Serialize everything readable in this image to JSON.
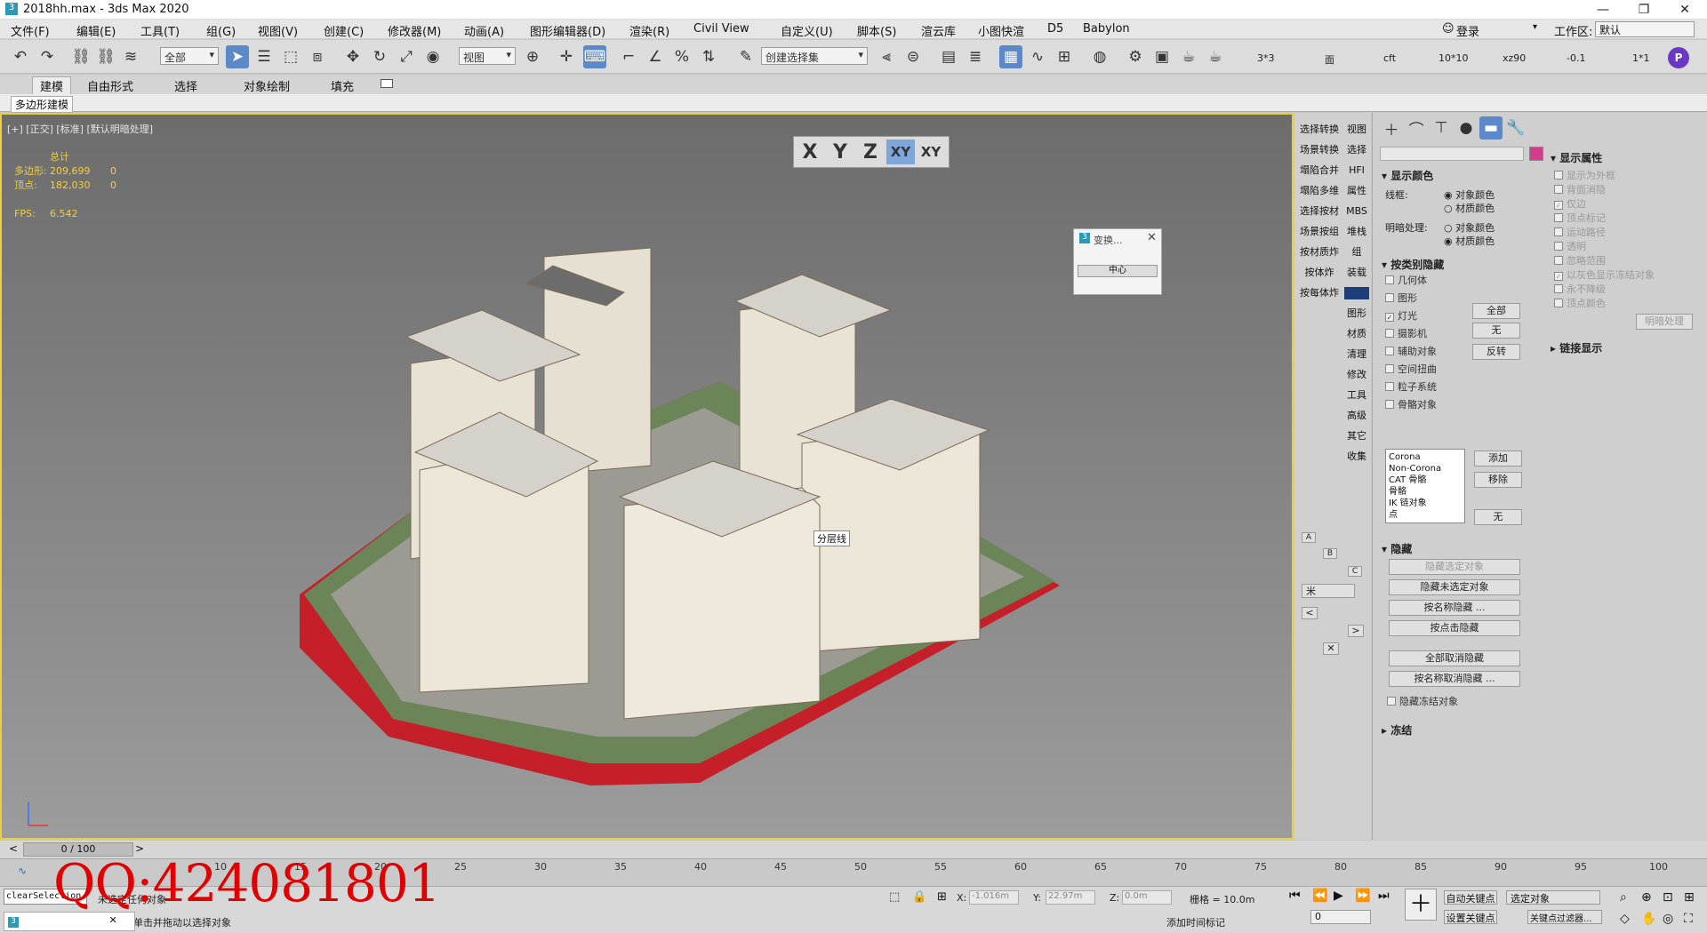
{
  "title": {
    "file": "2018hh.max - 3ds Max 2020"
  },
  "menu": [
    "文件(F)",
    "编辑(E)",
    "工具(T)",
    "组(G)",
    "视图(V)",
    "创建(C)",
    "修改器(M)",
    "动画(A)",
    "图形编辑器(D)",
    "渲染(R)",
    "Civil View",
    "自定义(U)",
    "脚本(S)",
    "渲云库",
    "小图快渲",
    "D5",
    "Babylon"
  ],
  "user": {
    "login": "登录",
    "workspace_label": "工作区:",
    "workspace_value": "默认"
  },
  "toolbar": {
    "filter": "全部",
    "refcoord": "视图",
    "selset": "创建选择集",
    "t1": "3*3",
    "t2": "面",
    "t3": "cft",
    "t4": "10*10",
    "t5": "xz90",
    "t6": "-0.1",
    "t7": "1*1"
  },
  "ribbon": {
    "tabs": [
      "建模",
      "自由形式",
      "选择",
      "对象绘制",
      "填充"
    ],
    "sub": "多边形建模"
  },
  "viewport": {
    "label": "[+] [正交] [标准] [默认明暗处理]",
    "stats_total": "总计",
    "poly_label": "多边形:",
    "poly_value": "209,699",
    "poly_sel": "0",
    "vert_label": "顶点:",
    "vert_value": "182,030",
    "vert_sel": "0",
    "fps_label": "FPS:",
    "fps_value": "6.542",
    "tooltip": "分层线"
  },
  "axis": [
    "X",
    "Y",
    "Z",
    "XY",
    "XY"
  ],
  "popup": {
    "title": "变换...",
    "button": "中心"
  },
  "side": {
    "left": [
      "选择转换",
      "场景转换",
      "塌陷合并",
      "塌陷多维",
      "选择按材",
      "场景按组",
      "按材质炸",
      "按体炸",
      "按每体炸"
    ],
    "right": [
      "视图",
      "选择",
      "HFI",
      "属性",
      "MBS",
      "堆栈",
      "组",
      "装载",
      "",
      "图形",
      "材质",
      "清理",
      "修改",
      "工具",
      "高级",
      "其它",
      "收集"
    ],
    "unit": "米",
    "abc": [
      "A",
      "B",
      "C"
    ]
  },
  "cmd": {
    "disp_color": "显示颜色",
    "wire": "线框:",
    "shade": "明暗处理:",
    "obj_color": "对象颜色",
    "mat_color": "材质颜色",
    "hide_by_cat": "按类别隐藏",
    "cats": [
      {
        "label": "几何体",
        "checked": false
      },
      {
        "label": "图形",
        "checked": false
      },
      {
        "label": "灯光",
        "checked": true
      },
      {
        "label": "摄影机",
        "checked": false
      },
      {
        "label": "辅助对象",
        "checked": false
      },
      {
        "label": "空间扭曲",
        "checked": false
      },
      {
        "label": "粒子系统",
        "checked": false
      },
      {
        "label": "骨骼对象",
        "checked": false
      }
    ],
    "all": "全部",
    "none": "无",
    "invert": "反转",
    "list": [
      "Corona",
      "Non-Corona",
      "CAT 骨骼",
      "骨骼",
      "IK 链对象",
      "点"
    ],
    "add": "添加",
    "remove": "移除",
    "none2": "无",
    "hide": "隐藏",
    "hide_btns": [
      "隐藏选定对象",
      "隐藏未选定对象",
      "按名称隐藏 ...",
      "按点击隐藏"
    ],
    "unhide_btns": [
      "全部取消隐藏",
      "按名称取消隐藏 ..."
    ],
    "hide_frozen": "隐藏冻结对象",
    "freeze": "冻结",
    "disp_props": "显示属性",
    "props": [
      {
        "label": "显示为外框",
        "checked": false
      },
      {
        "label": "背面消隐",
        "checked": false
      },
      {
        "label": "仅边",
        "checked": true
      },
      {
        "label": "顶点标记",
        "checked": false
      },
      {
        "label": "运动路径",
        "checked": false
      },
      {
        "label": "透明",
        "checked": false
      },
      {
        "label": "忽略范围",
        "checked": false
      },
      {
        "label": "以灰色显示冻结对象",
        "checked": true
      },
      {
        "label": "永不降级",
        "checked": false
      },
      {
        "label": "顶点颜色",
        "checked": false
      }
    ],
    "shaded_btn": "明暗处理",
    "link_disp": "链接显示"
  },
  "timeline": {
    "frame": "0 / 100",
    "ticks": [
      "10",
      "15",
      "20",
      "25",
      "30",
      "35",
      "40",
      "45",
      "50",
      "55",
      "60",
      "65",
      "70",
      "75",
      "80",
      "85",
      "90",
      "95",
      "100"
    ]
  },
  "status": {
    "script": "clearSelection",
    "sel": "未选定任何对象",
    "hint": "单击并拖动以选择对象",
    "x_label": "X:",
    "x": "-1.016m",
    "y_label": "Y:",
    "y": "22.97m",
    "z_label": "Z:",
    "z": "0.0m",
    "grid": "栅格 = 10.0m",
    "autokey": "自动关键点",
    "setkey": "设置关键点",
    "selobj": "选定对象",
    "keyfilter": "关键点过滤器...",
    "addtime": "添加时间标记",
    "frame": "0"
  },
  "watermark": "QQ:424081801"
}
